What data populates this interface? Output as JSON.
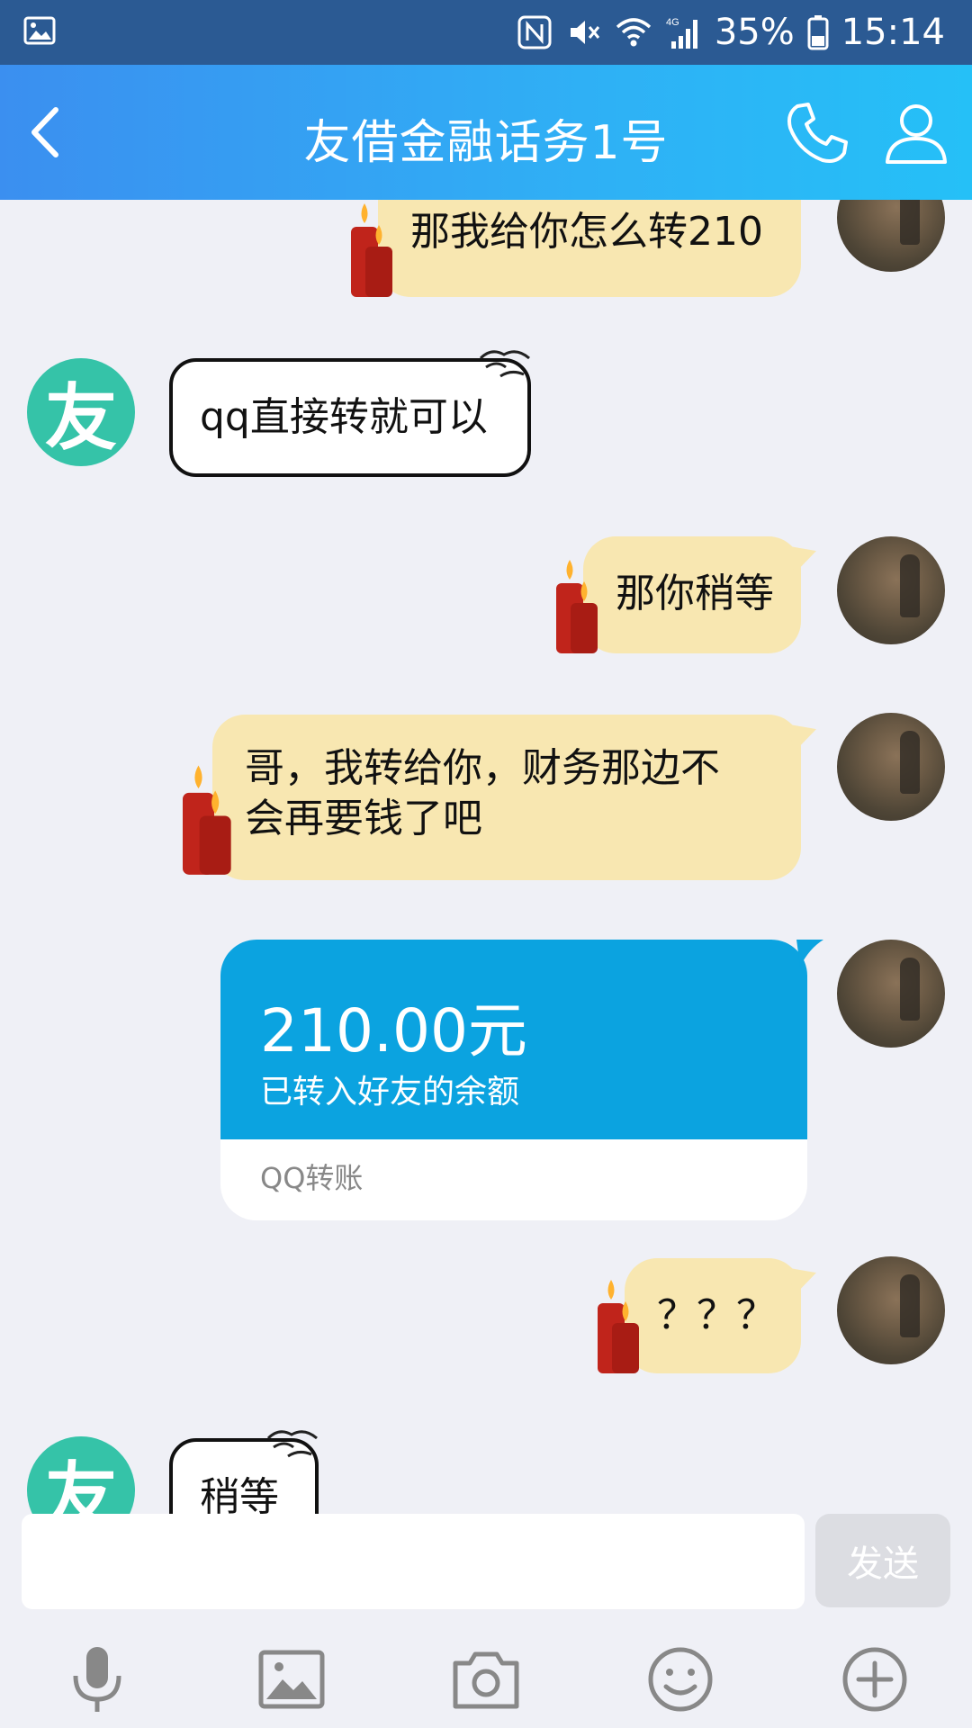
{
  "status_bar": {
    "battery": "35%",
    "time": "15:14",
    "icons": [
      "gallery-notification-icon",
      "nfc-icon",
      "mute-icon",
      "wifi-icon",
      "4g-signal-icon",
      "battery-icon"
    ]
  },
  "header": {
    "title": "友借金融话务1号",
    "icons": [
      "back-icon",
      "phone-icon",
      "profile-icon"
    ]
  },
  "contact_avatar_text": "友",
  "messages": [
    {
      "from": "me",
      "text": "那我给你怎么转210"
    },
    {
      "from": "contact",
      "text": "qq直接转就可以"
    },
    {
      "from": "me",
      "text": "那你稍等"
    },
    {
      "from": "me",
      "text_line1": "哥，我转给你，财务那边不",
      "text_line2": "会再要钱了吧"
    },
    {
      "from": "me",
      "type": "transfer",
      "amount": "210.00元",
      "desc": "已转入好友的余额",
      "label": "QQ转账"
    },
    {
      "from": "me",
      "text": "？？？"
    },
    {
      "from": "contact",
      "text": "稍等"
    }
  ],
  "composer": {
    "input_value": "",
    "send_label": "发送"
  },
  "toolbar": [
    "voice-icon",
    "image-icon",
    "camera-icon",
    "emoji-icon",
    "plus-icon"
  ],
  "colors": {
    "header_start": "#3b8ff0",
    "header_end": "#25c0f7",
    "bubble_me": "#f8e7b1",
    "transfer_blue": "#0ba3e0",
    "avatar_green": "#35c3a8"
  }
}
